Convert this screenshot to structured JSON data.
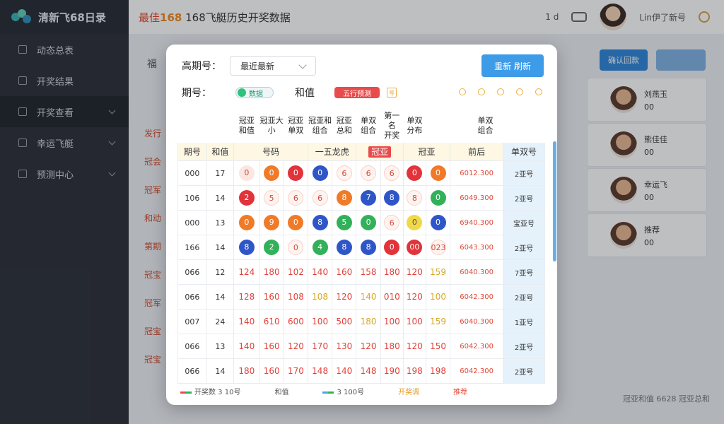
{
  "brand": {
    "name": "清新飞68日录"
  },
  "sidebar": {
    "items": [
      {
        "label": "动态总表",
        "active": false,
        "has_caret": false
      },
      {
        "label": "开奖结果",
        "active": false,
        "has_caret": false
      },
      {
        "label": "开奖查看",
        "active": true,
        "has_caret": true
      },
      {
        "label": "幸运飞艇",
        "active": false,
        "has_caret": true
      },
      {
        "label": "预测中心",
        "active": false,
        "has_caret": true
      }
    ]
  },
  "header": {
    "title_prefix": "最佳",
    "title_num": "168",
    "title_text": "168飞艇历史开奖数据",
    "right_text": "1 d",
    "user_name": "Lin伊了新号"
  },
  "background": {
    "label": "福",
    "btn1": "确认回款",
    "btn2": "",
    "left_rows": [
      "发行",
      "冠会",
      "冠军",
      "和动",
      "第期",
      "冠宝",
      "冠军",
      "冠宝",
      "冠宝"
    ],
    "users": [
      {
        "name": "刘燕玉",
        "code": "00"
      },
      {
        "name": "熊佳佳",
        "code": "00"
      },
      {
        "name": "幸运飞",
        "code": "00"
      },
      {
        "name": "推荐",
        "code": "00"
      }
    ],
    "footer": "冠亚和值 6628 冠亚总和"
  },
  "modal": {
    "period_label": "高期号：",
    "period_select": "最近最新",
    "query_button": "重新 刷新",
    "filter_label": "期号：",
    "chip_green": "数据",
    "sum_label": "和值",
    "chip_red": "五行预测",
    "chip_sq": "号",
    "table": {
      "headers": [
        "",
        "",
        "冠亚\n和值",
        "冠亚大\n小",
        "冠亚\n单双",
        "冠亚和\n组合",
        "冠亚\n总和",
        "单双\n组合",
        "第一名\n开奖",
        "单双\n分布",
        "单双\n组合"
      ],
      "subheaders": [
        "期号",
        "和值",
        "",
        "号码",
        "一五龙虎",
        "冠亚",
        "冠亚",
        "前后",
        "",
        "",
        "单双号"
      ],
      "rows": [
        {
          "period": "000",
          "sum": "17",
          "type": "balls",
          "cells": [
            [
              "0",
              "p"
            ],
            [
              "0",
              "o"
            ],
            [
              "0",
              "r"
            ],
            [
              "0",
              "b"
            ],
            [
              "6",
              "w"
            ],
            [
              "6",
              "w"
            ],
            [
              "6",
              "w"
            ],
            [
              "0",
              "r"
            ],
            [
              "0",
              "o"
            ],
            [
              "0",
              "r"
            ]
          ],
          "amount": "6012.300",
          "tail": "2亚号"
        },
        {
          "period": "106",
          "sum": "14",
          "type": "balls",
          "cells": [
            [
              "2",
              "r"
            ],
            [
              "5",
              "w"
            ],
            [
              "6",
              "w"
            ],
            [
              "6",
              "w"
            ],
            [
              "8",
              "o"
            ],
            [
              "7",
              "b"
            ],
            [
              "8",
              "b"
            ],
            [
              "8",
              "w"
            ],
            [
              "0",
              "g"
            ],
            [
              "",
              ""
            ]
          ],
          "amount": "6049.300",
          "tail": "2亚号"
        },
        {
          "period": "000",
          "sum": "13",
          "type": "balls",
          "cells": [
            [
              "0",
              "o"
            ],
            [
              "9",
              "o"
            ],
            [
              "0",
              "o"
            ],
            [
              "8",
              "b"
            ],
            [
              "5",
              "g"
            ],
            [
              "0",
              "g"
            ],
            [
              "6",
              "w"
            ],
            [
              "0",
              "y"
            ],
            [
              "0",
              "b"
            ],
            [
              "",
              ""
            ]
          ],
          "amount": "6940.300",
          "tail": "宝亚号"
        },
        {
          "period": "166",
          "sum": "14",
          "type": "balls",
          "cells": [
            [
              "8",
              "b"
            ],
            [
              "2",
              "g"
            ],
            [
              "0",
              "w"
            ],
            [
              "4",
              "g"
            ],
            [
              "8",
              "b"
            ],
            [
              "8",
              "b"
            ],
            [
              "0",
              "r"
            ],
            [
              "00",
              "r"
            ],
            [
              "023",
              "w"
            ],
            [
              "",
              ""
            ]
          ],
          "amount": "6043.300",
          "tail": "2亚号"
        },
        {
          "period": "066",
          "sum": "12",
          "type": "nums",
          "cells": [
            [
              "124",
              "r"
            ],
            [
              "180",
              "r"
            ],
            [
              "102",
              "r"
            ],
            [
              "140",
              "r"
            ],
            [
              "160",
              "r"
            ],
            [
              "158",
              "r"
            ],
            [
              "180",
              "r"
            ],
            [
              "120",
              "r"
            ],
            [
              "159",
              "y"
            ],
            [
              "",
              ""
            ]
          ],
          "amount": "6040.300",
          "tail": "7亚号"
        },
        {
          "period": "066",
          "sum": "14",
          "type": "nums",
          "cells": [
            [
              "128",
              "r"
            ],
            [
              "160",
              "r"
            ],
            [
              "108",
              "r"
            ],
            [
              "108",
              "y"
            ],
            [
              "120",
              "r"
            ],
            [
              "140",
              "y"
            ],
            [
              "010",
              "r"
            ],
            [
              "120",
              "r"
            ],
            [
              "100",
              "y"
            ],
            [
              "",
              ""
            ]
          ],
          "amount": "6042.300",
          "tail": "2亚号"
        },
        {
          "period": "007",
          "sum": "24",
          "type": "nums",
          "cells": [
            [
              "140",
              "r"
            ],
            [
              "610",
              "r"
            ],
            [
              "600",
              "r"
            ],
            [
              "100",
              "r"
            ],
            [
              "500",
              "r"
            ],
            [
              "180",
              "y"
            ],
            [
              "100",
              "r"
            ],
            [
              "100",
              "r"
            ],
            [
              "159",
              "y"
            ],
            [
              "",
              ""
            ]
          ],
          "amount": "6040.300",
          "tail": "1亚号"
        },
        {
          "period": "066",
          "sum": "13",
          "type": "nums",
          "cells": [
            [
              "140",
              "r"
            ],
            [
              "160",
              "r"
            ],
            [
              "120",
              "r"
            ],
            [
              "170",
              "r"
            ],
            [
              "130",
              "r"
            ],
            [
              "120",
              "r"
            ],
            [
              "180",
              "r"
            ],
            [
              "120",
              "r"
            ],
            [
              "150",
              "r"
            ],
            [
              "",
              ""
            ]
          ],
          "amount": "6042.300",
          "tail": "2亚号"
        },
        {
          "period": "066",
          "sum": "14",
          "type": "nums",
          "cells": [
            [
              "180",
              "r"
            ],
            [
              "160",
              "r"
            ],
            [
              "170",
              "r"
            ],
            [
              "148",
              "r"
            ],
            [
              "140",
              "r"
            ],
            [
              "148",
              "r"
            ],
            [
              "190",
              "r"
            ],
            [
              "198",
              "r"
            ],
            [
              "198",
              "r"
            ],
            [
              "",
              ""
            ]
          ],
          "amount": "6042.300",
          "tail": "2亚号"
        }
      ]
    },
    "footer": {
      "legend1": "开奖数 3 10号",
      "legend2": "和值",
      "legend3": "3 100号",
      "link1": "开奖调",
      "link2": "推荐"
    }
  }
}
